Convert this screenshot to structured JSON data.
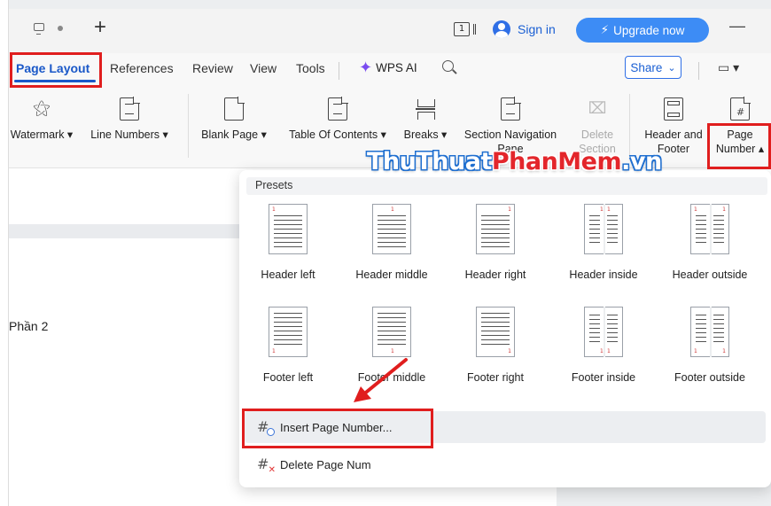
{
  "titlebar": {
    "sign_in": "Sign in",
    "upgrade": "Upgrade now",
    "page_count": "1",
    "minimize": "—"
  },
  "tabs": {
    "page_layout": "Page Layout",
    "references": "References",
    "review": "Review",
    "view": "View",
    "tools": "Tools",
    "wps_ai": "WPS AI",
    "share": "Share",
    "share_caret": "⌄",
    "comment": "▭ ▾"
  },
  "ribbon": {
    "watermark": "Watermark ▾",
    "line_numbers": "Line Numbers ▾",
    "blank_page": "Blank Page ▾",
    "toc": "Table Of Contents ▾",
    "breaks": "Breaks ▾",
    "section_nav_1": "Section Navigation",
    "section_nav_2": "Pane",
    "delete_1": "Delete",
    "delete_2": "Section",
    "header_footer_1": "Header and",
    "header_footer_2": "Footer",
    "page_number_1": "Page",
    "page_number_2": "Number ▴"
  },
  "document": {
    "text": "Phần 2"
  },
  "dropdown": {
    "presets_label": "Presets",
    "header_presets": [
      "Header left",
      "Header middle",
      "Header right",
      "Header inside",
      "Header outside"
    ],
    "footer_presets": [
      "Footer left",
      "Footer middle",
      "Footer right",
      "Footer inside",
      "Footer outside"
    ],
    "insert_page_number": "Insert Page Number...",
    "delete_page_num": "Delete Page Num"
  },
  "watermark": {
    "part1": "ThuThuat",
    "part2": "PhanMem",
    "part3": ".vn"
  },
  "colors": {
    "accent": "#1a58c8",
    "upgrade_button": "#3d8cf5",
    "annotation_red": "#e01e1e"
  }
}
